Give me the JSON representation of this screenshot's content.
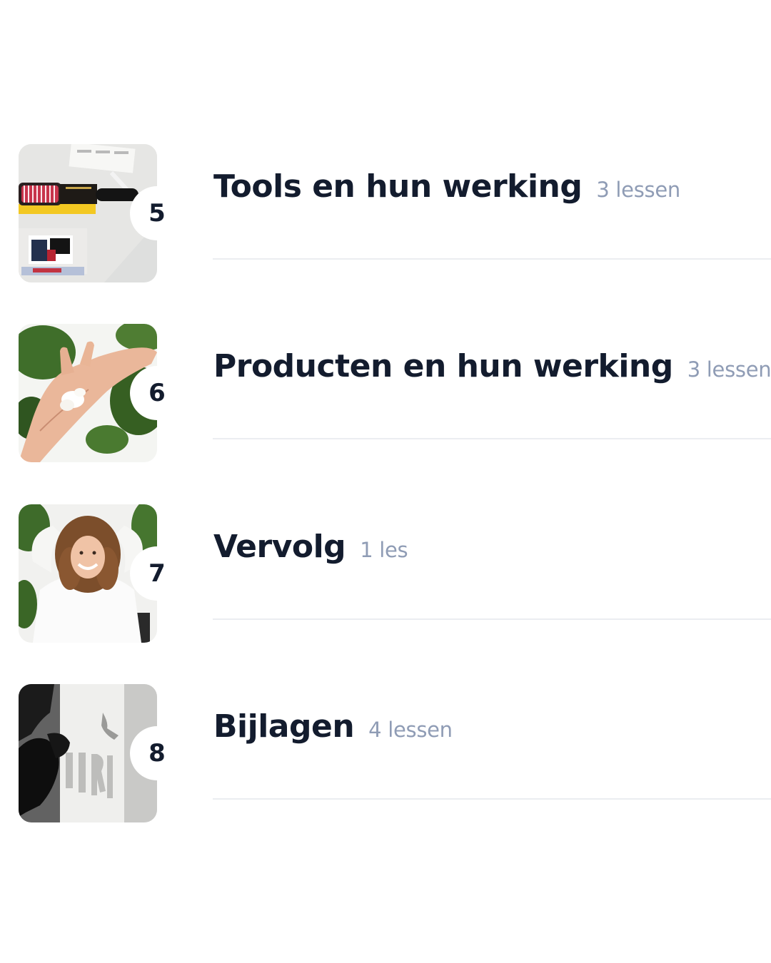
{
  "modules": [
    {
      "number": "5",
      "title": "Tools en hun werking",
      "lessons": "3 lessen",
      "image": "hairbrush-photo"
    },
    {
      "number": "6",
      "title": "Producten en hun werking",
      "lessons": "3 lessen",
      "image": "hand-with-cream-photo"
    },
    {
      "number": "7",
      "title": "Vervolg",
      "lessons": "1 les",
      "image": "smiling-woman-photo"
    },
    {
      "number": "8",
      "title": "Bijlagen",
      "lessons": "4 lessen",
      "image": "shadow-on-wall-photo"
    }
  ],
  "colors": {
    "title": "#131c2e",
    "lessonCount": "#8f9cb5",
    "divider": "#ebedf1",
    "badge": "#ffffff"
  }
}
